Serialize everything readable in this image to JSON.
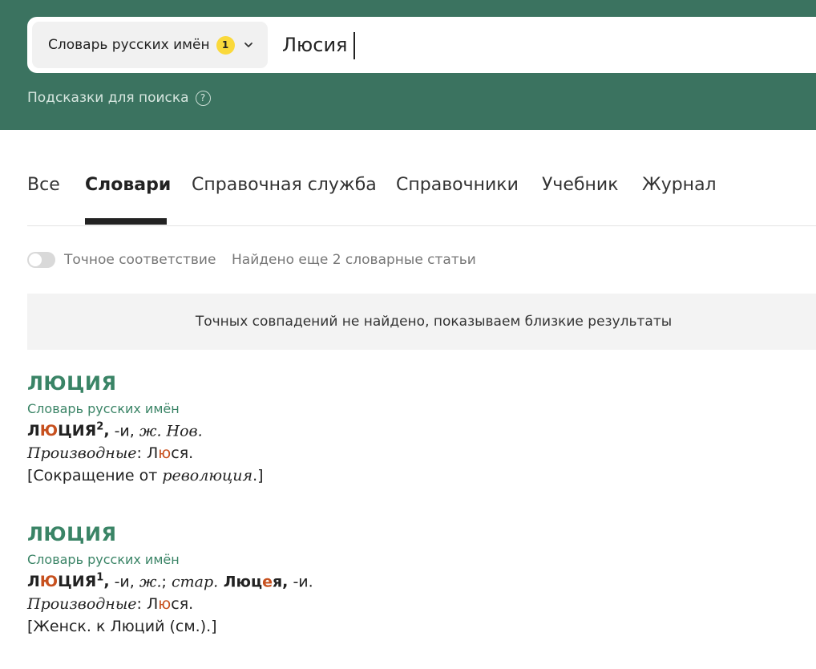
{
  "header": {
    "dictionary_select": {
      "label": "Словарь русских имён",
      "badge": "1"
    },
    "search": {
      "value": "Люсия"
    },
    "hints": {
      "label": "Подсказки для поиска",
      "help_symbol": "?"
    }
  },
  "tabs": [
    "Все",
    "Словари",
    "Справочная служба",
    "Справочники",
    "Учебник",
    "Журнал"
  ],
  "filters": {
    "exact_match_label": "Точное соответствие",
    "found_more": "Найдено еще 2 словарные статьи"
  },
  "notice": "Точных совпадений не найдено, показываем близкие результаты",
  "entries": [
    {
      "title": "ЛЮЦИЯ",
      "source": "Словарь русских имён",
      "hw_pre": "Л",
      "hw_acc": "Ю",
      "hw_post": "ЦИЯ",
      "sup": "2",
      "comma": ",",
      "grammar": " -и, ",
      "marks": "ж. Нов.",
      "derived_label": "Производные",
      "derived_colon": ": ",
      "derived_pre": "Л",
      "derived_acc": "ю",
      "derived_post": "ся.",
      "etym_open": "[Сокращение от ",
      "etym_word": "революция",
      "etym_close": ".]"
    },
    {
      "title": "ЛЮЦИЯ",
      "source": "Словарь русских имён",
      "hw_pre": "Л",
      "hw_acc": "Ю",
      "hw_post": "ЦИЯ",
      "sup": "1",
      "comma": ",",
      "grammar": " -и, ",
      "marks": "ж.",
      "sep": "; ",
      "old_mark": "стар.",
      "alt_pre": " Люц",
      "alt_acc": "е",
      "alt_post": "я,",
      "alt_grammar": " -и.",
      "derived_label": "Производные",
      "derived_colon": ": ",
      "derived_pre": "Л",
      "derived_acc": "ю",
      "derived_post": "ся.",
      "etym": "[Женск. к Люций (см.).]"
    }
  ],
  "colors": {
    "header_green": "#3b7360",
    "accent_green": "#3a8466",
    "stress_orange": "#c7501e",
    "badge_yellow": "#fad93b"
  }
}
